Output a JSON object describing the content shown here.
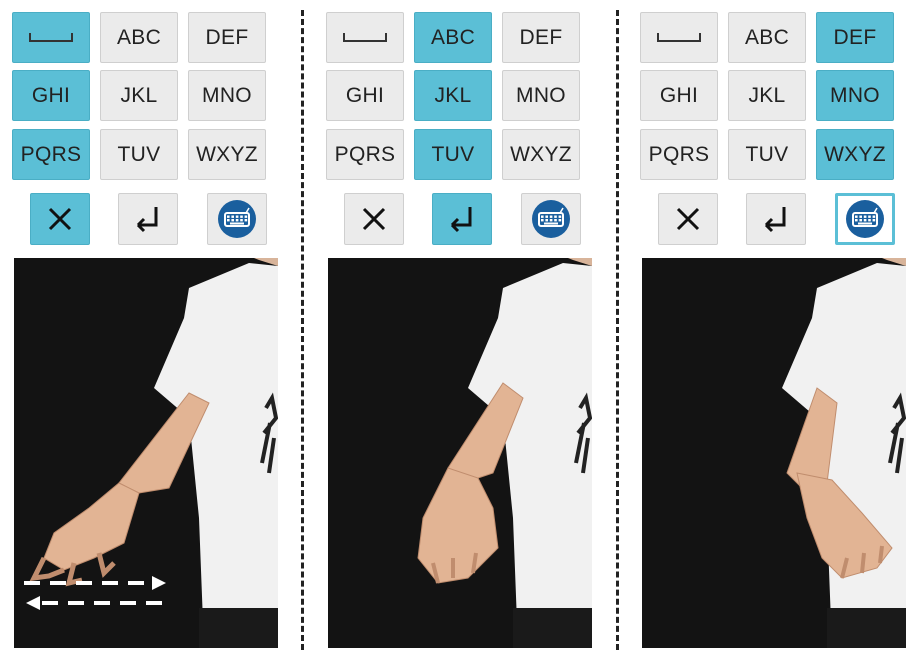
{
  "accent_color": "#5bbfd6",
  "panels": [
    {
      "keys": [
        {
          "label": "",
          "icon": "space-icon",
          "active": true
        },
        {
          "label": "ABC",
          "active": false
        },
        {
          "label": "DEF",
          "active": false
        },
        {
          "label": "GHI",
          "active": true
        },
        {
          "label": "JKL",
          "active": false
        },
        {
          "label": "MNO",
          "active": false
        },
        {
          "label": "PQRS",
          "active": true
        },
        {
          "label": "TUV",
          "active": false
        },
        {
          "label": "WXYZ",
          "active": false
        }
      ],
      "controls": [
        {
          "icon": "close-icon",
          "active": true
        },
        {
          "icon": "enter-icon",
          "active": false
        },
        {
          "icon": "keyboard-icon",
          "active": false
        }
      ],
      "gesture": "horizontal-swipe"
    },
    {
      "keys": [
        {
          "label": "",
          "icon": "space-icon",
          "active": false
        },
        {
          "label": "ABC",
          "active": true
        },
        {
          "label": "DEF",
          "active": false
        },
        {
          "label": "GHI",
          "active": false
        },
        {
          "label": "JKL",
          "active": true
        },
        {
          "label": "MNO",
          "active": false
        },
        {
          "label": "PQRS",
          "active": false
        },
        {
          "label": "TUV",
          "active": true
        },
        {
          "label": "WXYZ",
          "active": false
        }
      ],
      "controls": [
        {
          "icon": "close-icon",
          "active": false
        },
        {
          "icon": "enter-icon",
          "active": true
        },
        {
          "icon": "keyboard-icon",
          "active": false
        }
      ],
      "gesture": "wrist-flex"
    },
    {
      "keys": [
        {
          "label": "",
          "icon": "space-icon",
          "active": false
        },
        {
          "label": "ABC",
          "active": false
        },
        {
          "label": "DEF",
          "active": true
        },
        {
          "label": "GHI",
          "active": false
        },
        {
          "label": "JKL",
          "active": false
        },
        {
          "label": "MNO",
          "active": true
        },
        {
          "label": "PQRS",
          "active": false
        },
        {
          "label": "TUV",
          "active": false
        },
        {
          "label": "WXYZ",
          "active": true
        }
      ],
      "controls": [
        {
          "icon": "close-icon",
          "active": false
        },
        {
          "icon": "enter-icon",
          "active": false
        },
        {
          "icon": "keyboard-icon",
          "active": true
        }
      ],
      "gesture": "wrist-extend"
    }
  ]
}
